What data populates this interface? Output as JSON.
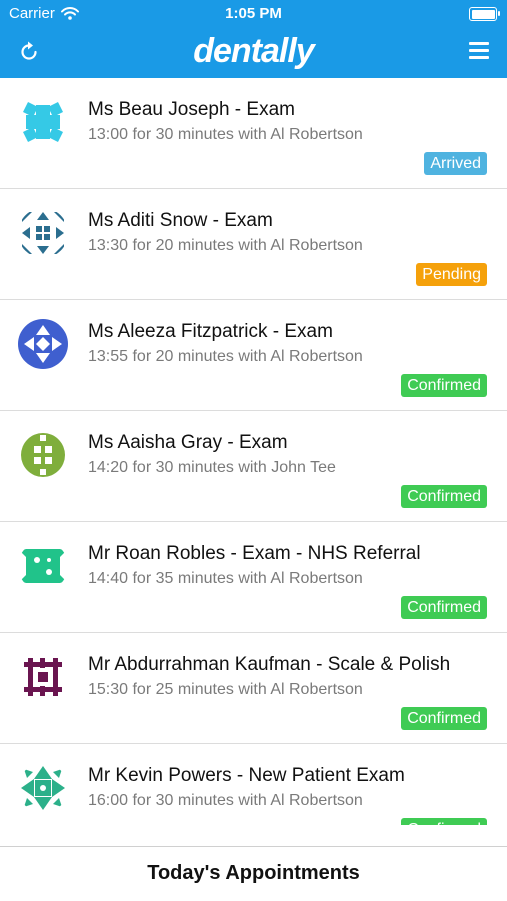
{
  "status_bar": {
    "carrier": "Carrier",
    "time": "1:05 PM"
  },
  "nav": {
    "brand": "dentally",
    "refresh_icon": "refresh-icon",
    "menu_icon": "hamburger-menu-icon"
  },
  "appointments": [
    {
      "title": "Ms Beau Joseph - Exam",
      "detail": "13:00 for 30 minutes with Al Robertson",
      "status": "Arrived",
      "status_color": "#4fb3e0",
      "avatar_color": "#35c9e6"
    },
    {
      "title": "Ms Aditi Snow - Exam",
      "detail": "13:30 for 20 minutes with Al Robertson",
      "status": "Pending",
      "status_color": "#f5a10b",
      "avatar_color": "#2b6e8f"
    },
    {
      "title": "Ms Aleeza Fitzpatrick - Exam",
      "detail": "13:55 for 20 minutes with Al Robertson",
      "status": "Confirmed",
      "status_color": "#3fcb54",
      "avatar_color": "#3f5fcf"
    },
    {
      "title": "Ms Aaisha Gray - Exam",
      "detail": "14:20 for 30 minutes with John Tee",
      "status": "Confirmed",
      "status_color": "#3fcb54",
      "avatar_color": "#7fae3c"
    },
    {
      "title": "Mr Roan Robles - Exam - NHS Referral",
      "detail": "14:40 for 35 minutes with Al Robertson",
      "status": "Confirmed",
      "status_color": "#3fcb54",
      "avatar_color": "#21c38a"
    },
    {
      "title": "Mr Abdurrahman Kaufman - Scale & Polish",
      "detail": "15:30 for 25 minutes with Al Robertson",
      "status": "Confirmed",
      "status_color": "#3fcb54",
      "avatar_color": "#6a1550"
    },
    {
      "title": "Mr Kevin Powers - New Patient Exam",
      "detail": "16:00 for 30 minutes with Al Robertson",
      "status": "Confirmed",
      "status_color": "#3fcb54",
      "avatar_color": "#2cb08a"
    }
  ],
  "bottom_bar": {
    "label": "Today's Appointments"
  }
}
